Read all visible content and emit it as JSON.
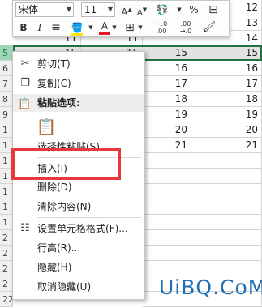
{
  "toolbar": {
    "font_name": "宋体",
    "font_size": "11",
    "grow_font": "A",
    "shrink_font": "A",
    "bold": "B",
    "italic": "I",
    "font_color_glyph": "A"
  },
  "grid": {
    "rows": [
      {
        "num": "",
        "a": "",
        "b": "13",
        "col_b_show": true
      },
      {
        "num": "",
        "a": "",
        "b": "14"
      },
      {
        "num": "5",
        "a": "15",
        "mid": "15",
        "b": "15",
        "selected": true
      },
      {
        "num": "6",
        "mid": "16",
        "b": "16"
      },
      {
        "num": "7",
        "mid": "17",
        "b": "17"
      },
      {
        "num": "8",
        "mid": "18",
        "b": "18"
      },
      {
        "num": "9",
        "mid": "19",
        "b": "19"
      },
      {
        "num": "1",
        "mid": "20",
        "b": "20"
      },
      {
        "num": "1",
        "mid": "21",
        "b": "21"
      }
    ],
    "top_values": {
      "r2": "12",
      "r3": "13",
      "r4": "14",
      "r4_left": "11",
      "r4_mid": "11"
    }
  },
  "context_menu": {
    "cut": "剪切(T)",
    "copy": "复制(C)",
    "paste_options": "粘贴选项:",
    "paste_special": "选择性粘贴(S)...",
    "insert": "插入(I)",
    "delete": "删除(D)",
    "clear_contents": "清除内容(N)",
    "format_cells": "设置单元格格式(F)...",
    "row_height": "行高(R)...",
    "hide": "隐藏(H)",
    "unhide": "取消隐藏(U)"
  },
  "row_numbers_left": [
    "1",
    "1",
    "1",
    "1",
    "1",
    "1",
    "1",
    "1",
    "2",
    "2",
    "2",
    "2",
    "22"
  ],
  "watermark": "UiBQ.CoM",
  "colors": {
    "highlight": "#e8383d",
    "excel_green": "#217346",
    "watermark": "#1f6fb2"
  }
}
